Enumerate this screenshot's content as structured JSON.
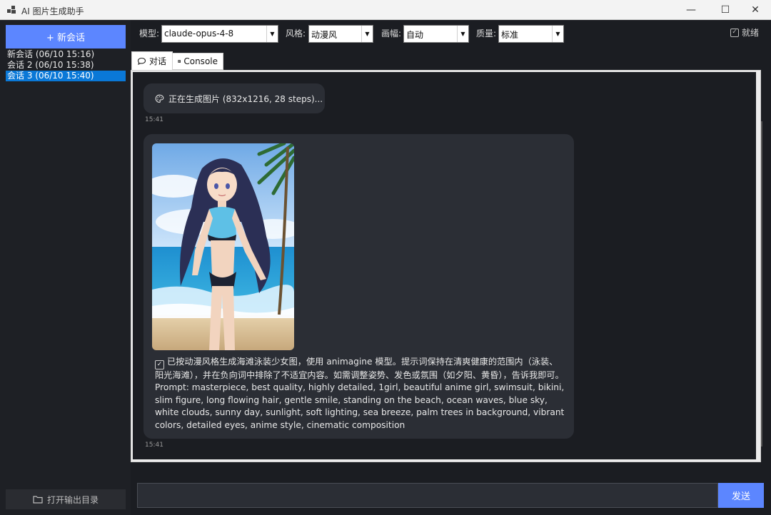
{
  "window": {
    "title": "AI 图片生成助手",
    "min": "—",
    "max": "☐",
    "close": "✕"
  },
  "sidebar": {
    "new_chat": "+ 新会话",
    "sessions": [
      {
        "label": "新会话 (06/10 15:16)",
        "active": false
      },
      {
        "label": "会话 2 (06/10 15:38)",
        "active": false
      },
      {
        "label": "会话 3 (06/10 15:40)",
        "active": true
      }
    ],
    "open_dir": "打开输出目录"
  },
  "toolbar": {
    "model_label": "模型:",
    "model_value": "claude-opus-4-8",
    "style_label": "风格:",
    "style_value": "动漫风",
    "size_label": "画幅:",
    "size_value": "自动",
    "quality_label": "质量:",
    "quality_value": "标准",
    "status": "就绪"
  },
  "tabs": [
    {
      "label": "对话",
      "icon": "speech-bubble-icon"
    },
    {
      "label": "Console",
      "icon": "console-icon"
    }
  ],
  "messages": [
    {
      "text": "正在生成图片 (832x1216, 28 steps)...",
      "time": "15:41",
      "icon": "palette-icon"
    },
    {
      "text": "已按动漫风格生成海滩泳装少女图，使用 animagine 模型。提示词保持在清爽健康的范围内（泳装、阳光海滩），并在负向词中排除了不适宜内容。如需调整姿势、发色或氛围（如夕阳、黄昏），告诉我即可。",
      "prompt": "Prompt: masterpiece, best quality, highly detailed, 1girl, beautiful anime girl, swimsuit, bikini, slim figure, long flowing hair, gentle smile, standing on the beach, ocean waves, blue sky, white clouds, sunny day, sunlight, soft lighting, sea breeze, palm trees in background, vibrant colors, detailed eyes, anime style, cinematic composition",
      "time": "15:41",
      "icon": "checkbox-icon"
    }
  ],
  "input": {
    "placeholder": "",
    "send": "发送"
  },
  "colors": {
    "accent": "#5c86ff",
    "selection": "#0a78d7",
    "background": "#1b1d22",
    "bubble": "#2b2e35"
  }
}
